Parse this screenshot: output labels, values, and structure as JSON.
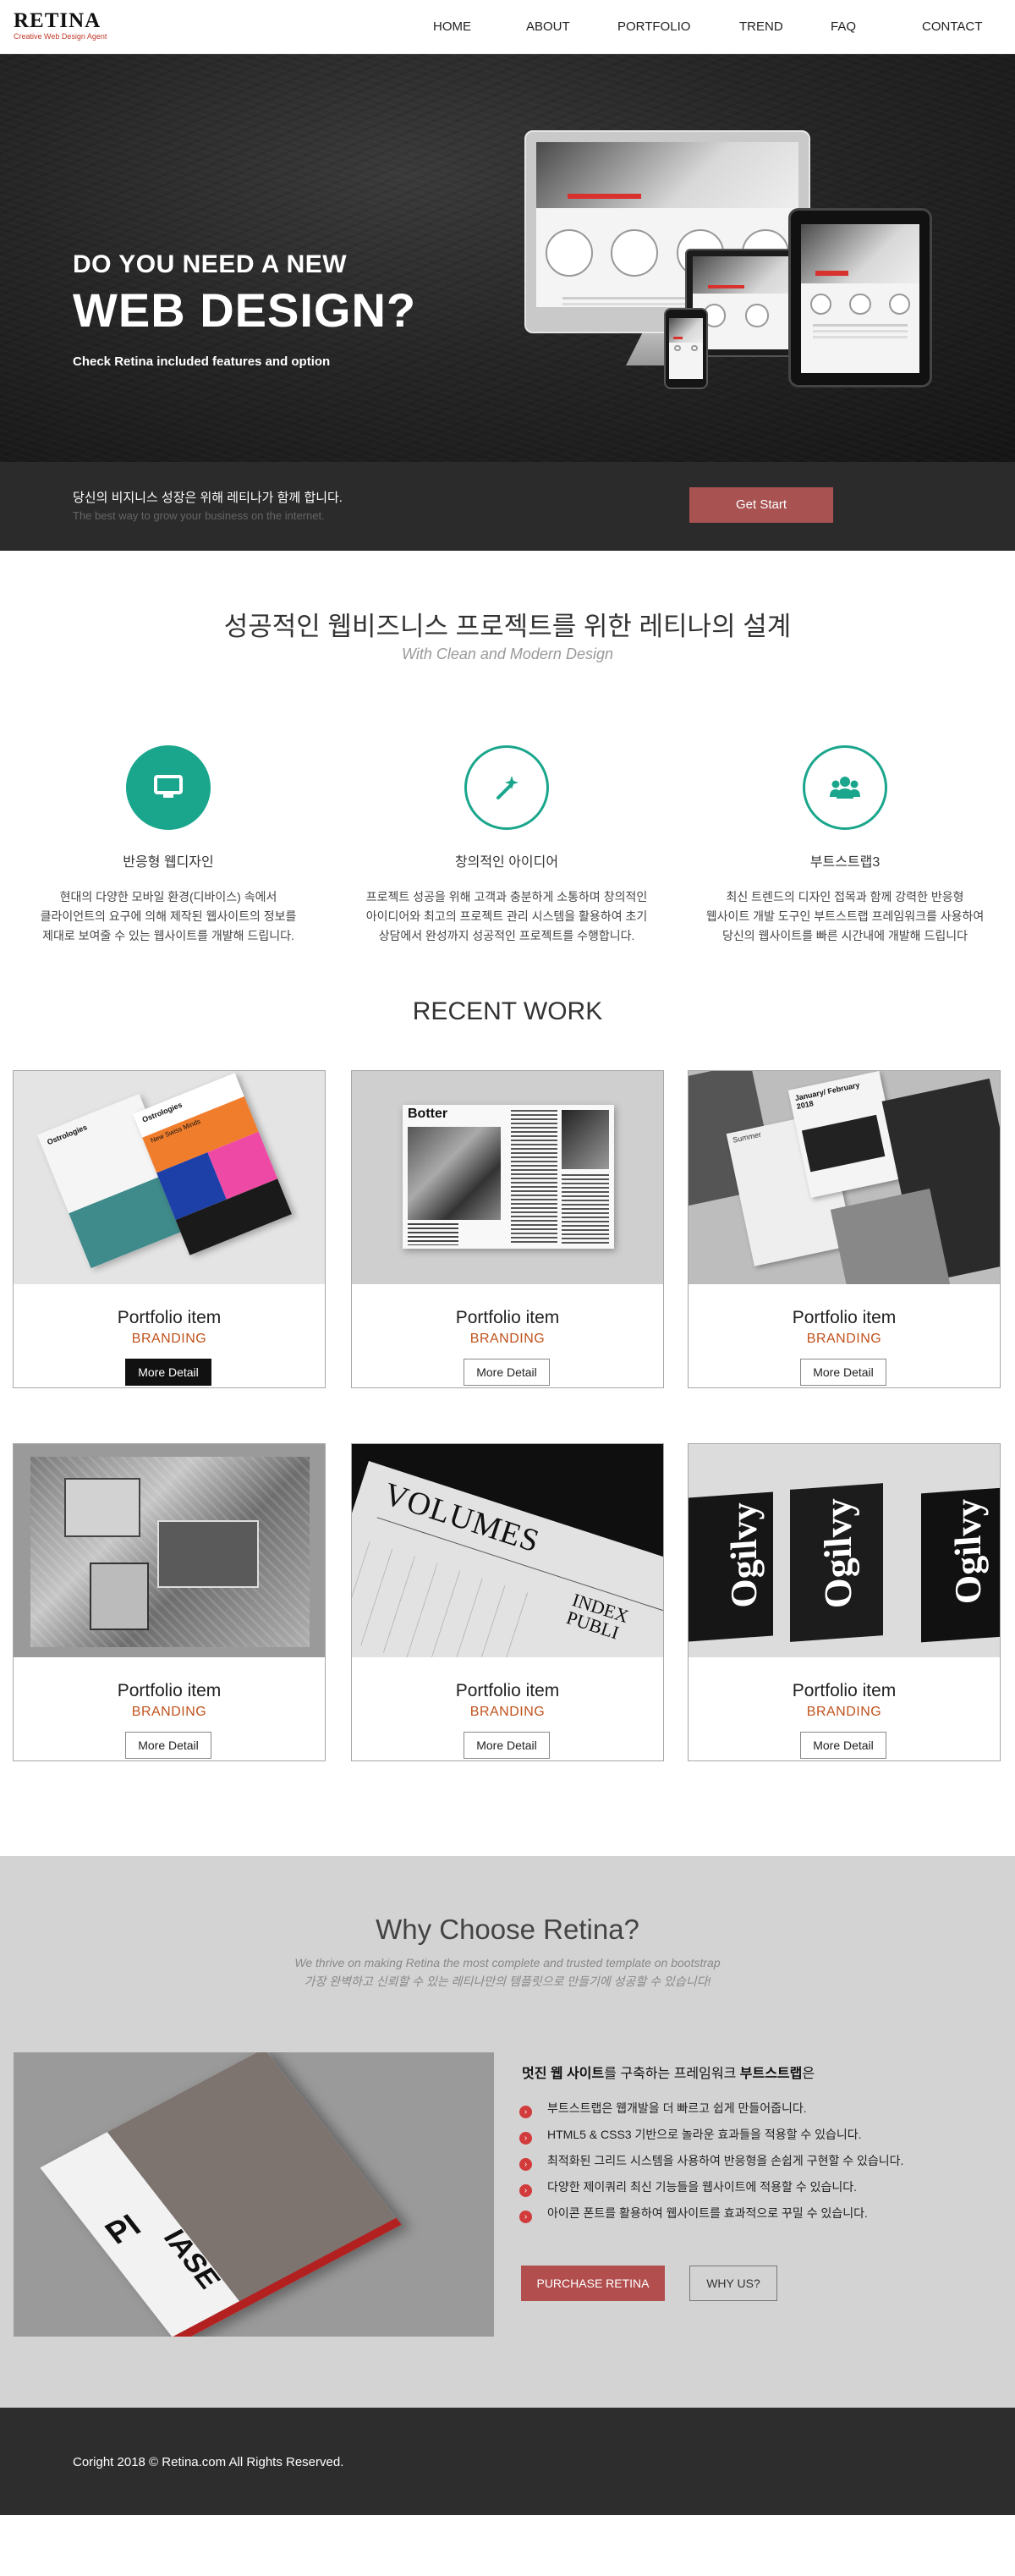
{
  "header": {
    "logo": "RETINA",
    "tagline": "Creative Web Design Agent",
    "nav": [
      "HOME",
      "ABOUT",
      "PORTFOLIO",
      "TREND",
      "FAQ",
      "CONTACT"
    ]
  },
  "hero": {
    "line1": "DO YOU NEED A NEW",
    "line2": "WEB DESIGN?",
    "sub": "Check Retina included features and option"
  },
  "strip": {
    "main": "당신의 비지니스 성장은 위해 레티나가 함께 합니다.",
    "sub": "The best way to grow your business on the internet.",
    "button": "Get Start"
  },
  "features": {
    "title": "성공적인 웹비즈니스 프로젝트를 위한 레티나의 설계",
    "subtitle": "With Clean and Modern Design",
    "items": [
      {
        "icon": "monitor-icon",
        "title": "반응형 웹디자인",
        "desc": [
          "현대의 다양한 모바일 환경(디바이스) 속에서",
          "클라이언트의 요구에 의해 제작된 웹사이트의 정보를",
          "제대로 보여줄 수 있는 웹사이트를 개발해 드립니다."
        ]
      },
      {
        "icon": "magic-wand-icon",
        "title": "창의적인 아이디어",
        "desc": [
          "프로젝트 성공을 위해 고객과 충분하게 소통하며 창의적인",
          "아이디어와 최고의 프로젝트 관리 시스템을 활용하여 초기",
          "상담에서 완성까지 성공적인 프로젝트를 수행합니다."
        ]
      },
      {
        "icon": "users-icon",
        "title": "부트스트랩3",
        "desc": [
          "최신 트렌드의 디자인 접목과 함께 강력한 반응형",
          "웹사이트 개발 도구인 부트스트랩 프레임워크를 사용하여",
          "당신의 웹사이트를 빠른 시간내에 개발해 드립니다"
        ]
      }
    ]
  },
  "work": {
    "title": "RECENT WORK",
    "items": [
      {
        "title": "Portfolio item",
        "category": "BRANDING",
        "button": "More Detail"
      },
      {
        "title": "Portfolio item",
        "category": "BRANDING",
        "button": "More Detail"
      },
      {
        "title": "Portfolio item",
        "category": "BRANDING",
        "button": "More Detail"
      },
      {
        "title": "Portfolio item",
        "category": "BRANDING",
        "button": "More Detail"
      },
      {
        "title": "Portfolio item",
        "category": "BRANDING",
        "button": "More Detail"
      },
      {
        "title": "Portfolio item",
        "category": "BRANDING",
        "button": "More Detail"
      }
    ],
    "mock_text": {
      "book1_title": "Ostrologies",
      "book2_title": "Ostrologies",
      "book2_sub": "New Swiss Minds",
      "poster_title": "Botter",
      "mag_title": "Summer",
      "mag_date": "January/ February 2018",
      "volumes": "VOLUMES",
      "index_text": "INDEX PUBLI",
      "ogilvy": "Ogilvy"
    }
  },
  "why": {
    "title": "Why Choose Retina?",
    "sub1": "We thrive on making Retina the most complete and trusted template on bootstrap",
    "sub2": "가장 완벽하고 신뢰할 수 있는 레티나만의 템플릿으로 만들기에 성공할 수 있습니다!",
    "lead_b1": "멋진 웹 사이트",
    "lead_mid": "를 구축하는 프레임워크 ",
    "lead_b2": "부트스트랩",
    "lead_end": "은",
    "list": [
      "부트스트랩은 웹개발을 더 빠르고 쉽게 만들어줍니다.",
      "HTML5 & CSS3 기반으로 놀라운 효과들을 적용할 수 있습니다.",
      "최적화된 그리드 시스템을 사용하여 반응형을 손쉽게 구현할 수 있습니다.",
      "다양한 제이쿼리 최신 기능들을 웹사이트에 적용할 수 있습니다.",
      "아이콘 폰트를 활용하여 웹사이트를 효과적으로 꾸밀 수 있습니다."
    ],
    "image_text": {
      "p": "PI",
      "ase": "IASE"
    },
    "btn_buy": "PURCHASE RETINA",
    "btn_why": "WHY US?"
  },
  "footer": {
    "text": "Coright 2018 © Retina.com All Rights Reserved."
  },
  "colors": {
    "accent": "#1aa68c",
    "brand_red": "#b24e4e",
    "category": "#c0521c"
  }
}
